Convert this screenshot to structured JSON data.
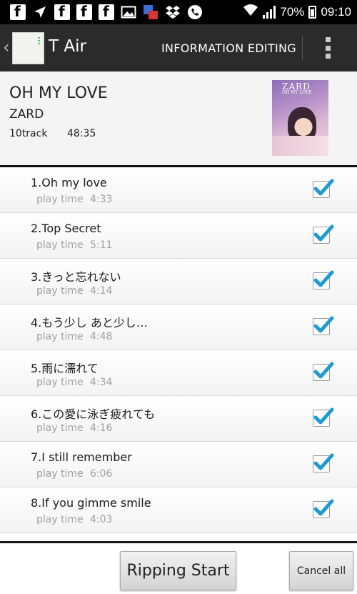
{
  "status_bar": {
    "battery": "70%",
    "time": "09:10",
    "left_icons": [
      "facebook-icon",
      "location-arrow-icon",
      "facebook-icon",
      "facebook-icon",
      "facebook-icon",
      "gallery-icon",
      "calendar-pdf-icon",
      "dropbox-icon",
      "viber-phone-icon"
    ]
  },
  "action_bar": {
    "app_title": "T Air",
    "action_label": "INFORMATION EDITING"
  },
  "album": {
    "title": "OH MY LOVE",
    "artist": "ZARD",
    "track_count": "10track",
    "duration": "48:35",
    "cover": {
      "artist": "ZARD",
      "title": "OH MY LOVE"
    }
  },
  "tracks": [
    {
      "name": "1.Oh my love",
      "time_label": "play time",
      "time": "4:33",
      "checked": true
    },
    {
      "name": "2.Top Secret",
      "time_label": "play time",
      "time": "5:11",
      "checked": true
    },
    {
      "name": "3.きっと忘れない",
      "time_label": "play time",
      "time": "4:14",
      "checked": true
    },
    {
      "name": "4.もう少し あと少し…",
      "time_label": "play time",
      "time": "4:48",
      "checked": true
    },
    {
      "name": "5.雨に濡れて",
      "time_label": "play time",
      "time": "4:34",
      "checked": true
    },
    {
      "name": "6.この愛に泳ぎ疲れても",
      "time_label": "play time",
      "time": "4:16",
      "checked": true
    },
    {
      "name": "7.I still remember",
      "time_label": "play time",
      "time": "6:06",
      "checked": true
    },
    {
      "name": "8.If you gimme smile",
      "time_label": "play time",
      "time": "4:03",
      "checked": true
    }
  ],
  "buttons": {
    "rip": "Ripping Start",
    "cancel": "Cancel all"
  },
  "colors": {
    "action_bar": "#2b2b2b",
    "check": "#1e9ad6"
  }
}
